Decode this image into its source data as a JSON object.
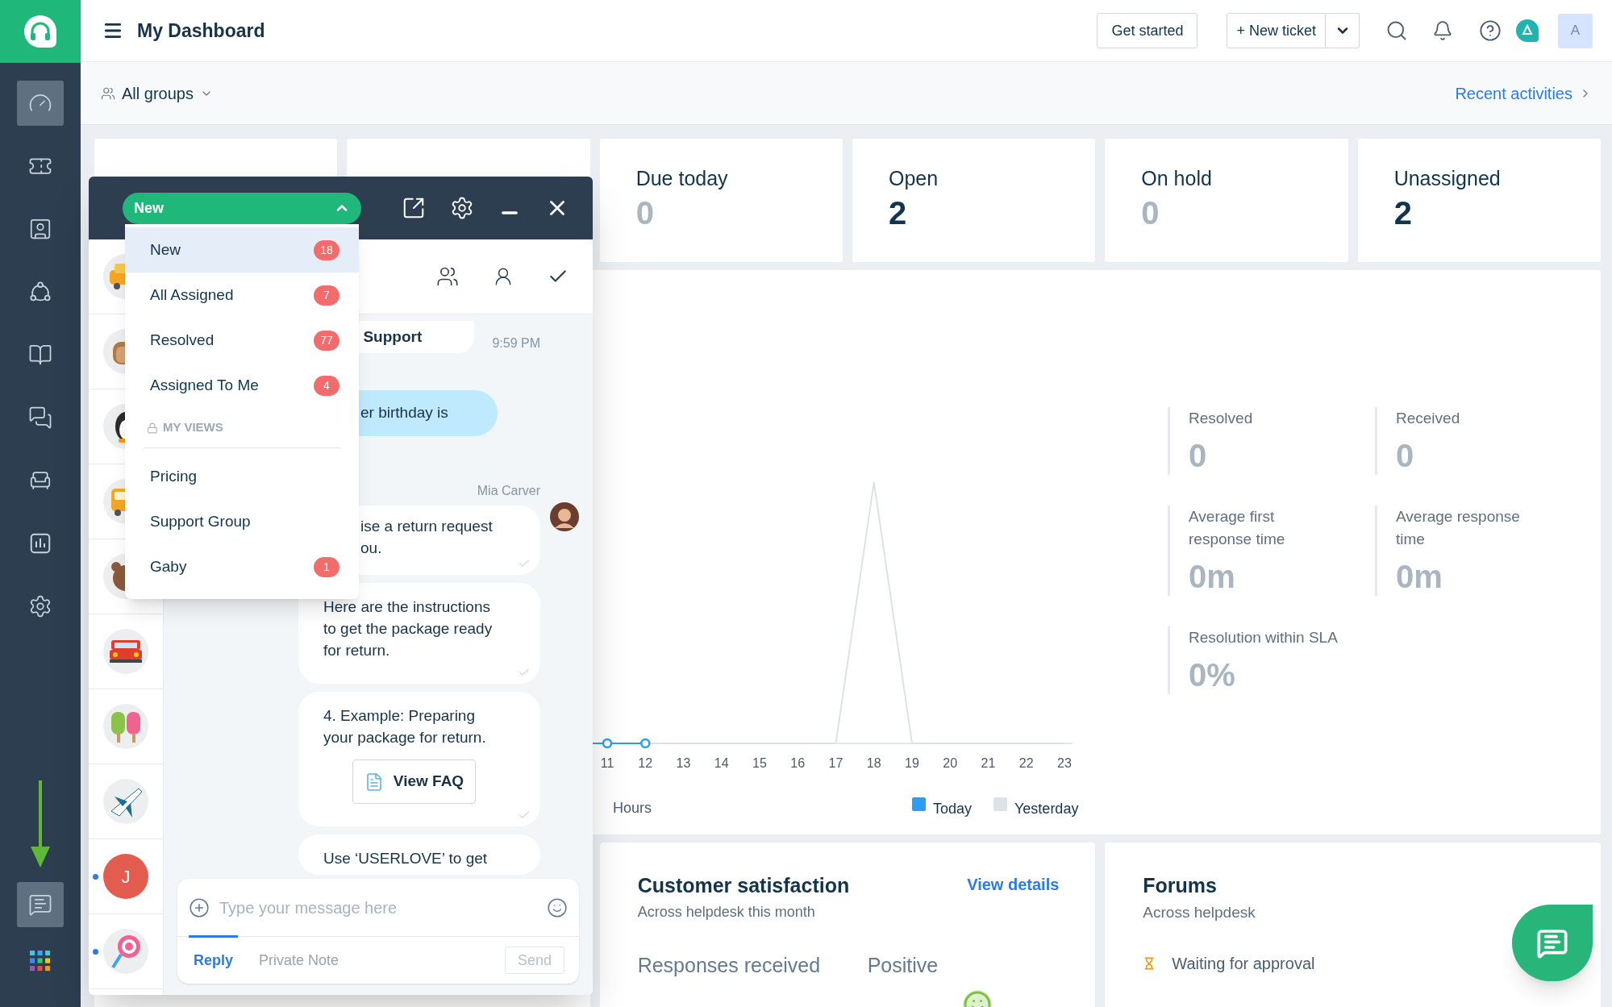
{
  "sidebar": {
    "items": [
      {
        "kind": "dashboard",
        "selected": true
      },
      {
        "kind": "tickets",
        "selected": false
      },
      {
        "kind": "contacts",
        "selected": false
      },
      {
        "kind": "nodes",
        "selected": false
      },
      {
        "kind": "knowledge",
        "selected": false
      },
      {
        "kind": "conversations",
        "selected": false
      },
      {
        "kind": "bots",
        "selected": false
      },
      {
        "kind": "reports",
        "selected": false
      },
      {
        "kind": "settings",
        "selected": false
      }
    ],
    "bottom_items": [
      {
        "kind": "chat",
        "selected": true
      },
      {
        "kind": "apps",
        "selected": false
      }
    ]
  },
  "topbar": {
    "title": "My Dashboard",
    "get_started": "Get started",
    "new_ticket": "+ New ticket",
    "avatar": "A"
  },
  "filter_bar": {
    "group": "All groups",
    "link": "Recent activities"
  },
  "summary_cards": [
    {
      "kind": "covered"
    },
    {
      "kind": "covered"
    },
    {
      "kind": "stat",
      "label": "Due today",
      "value": "0",
      "active": false
    },
    {
      "kind": "stat",
      "label": "Open",
      "value": "2",
      "active": true
    },
    {
      "kind": "stat",
      "label": "On hold",
      "value": "0",
      "active": false
    },
    {
      "kind": "stat",
      "label": "Unassigned",
      "value": "2",
      "active": true
    }
  ],
  "activity_panel": {
    "chart": {
      "x_labels": [
        "11",
        "12",
        "13",
        "14",
        "15",
        "16",
        "17",
        "18",
        "19",
        "20",
        "21",
        "22",
        "23"
      ],
      "axis_title": "Hours",
      "legend": [
        {
          "label": "Today",
          "color": "#2d9cf5"
        },
        {
          "label": "Yesterday",
          "color": "#dde2e7"
        }
      ]
    },
    "stats": [
      {
        "label": "Resolved",
        "value": "0"
      },
      {
        "label": "Received",
        "value": "0"
      },
      {
        "label": "Average first response time",
        "value": "0m"
      },
      {
        "label": "Average response time",
        "value": "0m"
      },
      {
        "label": "Resolution within SLA",
        "value": "0%"
      }
    ]
  },
  "bottom_cards": [
    {
      "kind": "list"
    },
    {
      "kind": "satisfaction",
      "title": "Customer satisfaction",
      "subtitle": "Across helpdesk this month",
      "link": "View details",
      "metrics": [
        {
          "label": "Responses received"
        },
        {
          "label": "Positive"
        }
      ]
    },
    {
      "kind": "forums",
      "title": "Forums",
      "subtitle": "Across helpdesk",
      "metrics": [
        {
          "label": "Waiting for approval"
        }
      ]
    }
  ],
  "chat_widget": {
    "view": {
      "label": "New",
      "open": true
    },
    "dropdown": {
      "items": [
        {
          "label": "New",
          "count": "18",
          "selected": true
        },
        {
          "label": "All Assigned",
          "count": "7",
          "selected": false
        },
        {
          "label": "Resolved",
          "count": "77",
          "selected": false
        },
        {
          "label": "Assigned To Me",
          "count": "4",
          "selected": false
        }
      ],
      "section": "MY VIEWS",
      "views": [
        {
          "label": "Pricing",
          "selected": false
        },
        {
          "label": "Support Group",
          "selected": false
        },
        {
          "label": "Gaby",
          "count": "1",
          "selected": false
        }
      ]
    },
    "conversations": [
      {
        "kind": "taxi",
        "unread": false
      },
      {
        "kind": "bread",
        "unread": false
      },
      {
        "kind": "penguin",
        "unread": false
      },
      {
        "kind": "bus",
        "unread": false
      },
      {
        "kind": "bear",
        "unread": false
      },
      {
        "kind": "jeep",
        "unread": false
      },
      {
        "kind": "popsicles",
        "unread": false
      },
      {
        "kind": "plane",
        "unread": false
      },
      {
        "kind": "initial",
        "initial": "J",
        "unread": true
      },
      {
        "kind": "lollipop",
        "unread": true
      }
    ],
    "messages": [
      {
        "kind": "agent_partial",
        "text": "Support",
        "time": "9:59 PM"
      },
      {
        "kind": "customer",
        "text": "er birthday is"
      },
      {
        "kind": "author",
        "text": "Mia Carver"
      },
      {
        "kind": "agent_cut",
        "text": "ise a return request\nou."
      },
      {
        "kind": "agent",
        "text": "Here are the instructions to get the package ready for return."
      },
      {
        "kind": "agent",
        "text": "4. Example: Preparing your package for return.",
        "button": "View FAQ"
      },
      {
        "kind": "agent_last",
        "text": "Use ‘USERLOVE’ to get"
      }
    ],
    "composer": {
      "placeholder": "Type your message here",
      "tabs": [
        {
          "label": "Reply",
          "selected": true
        },
        {
          "label": "Private Note",
          "selected": false
        }
      ],
      "send": {
        "label": "Send",
        "disabled": true
      }
    }
  }
}
